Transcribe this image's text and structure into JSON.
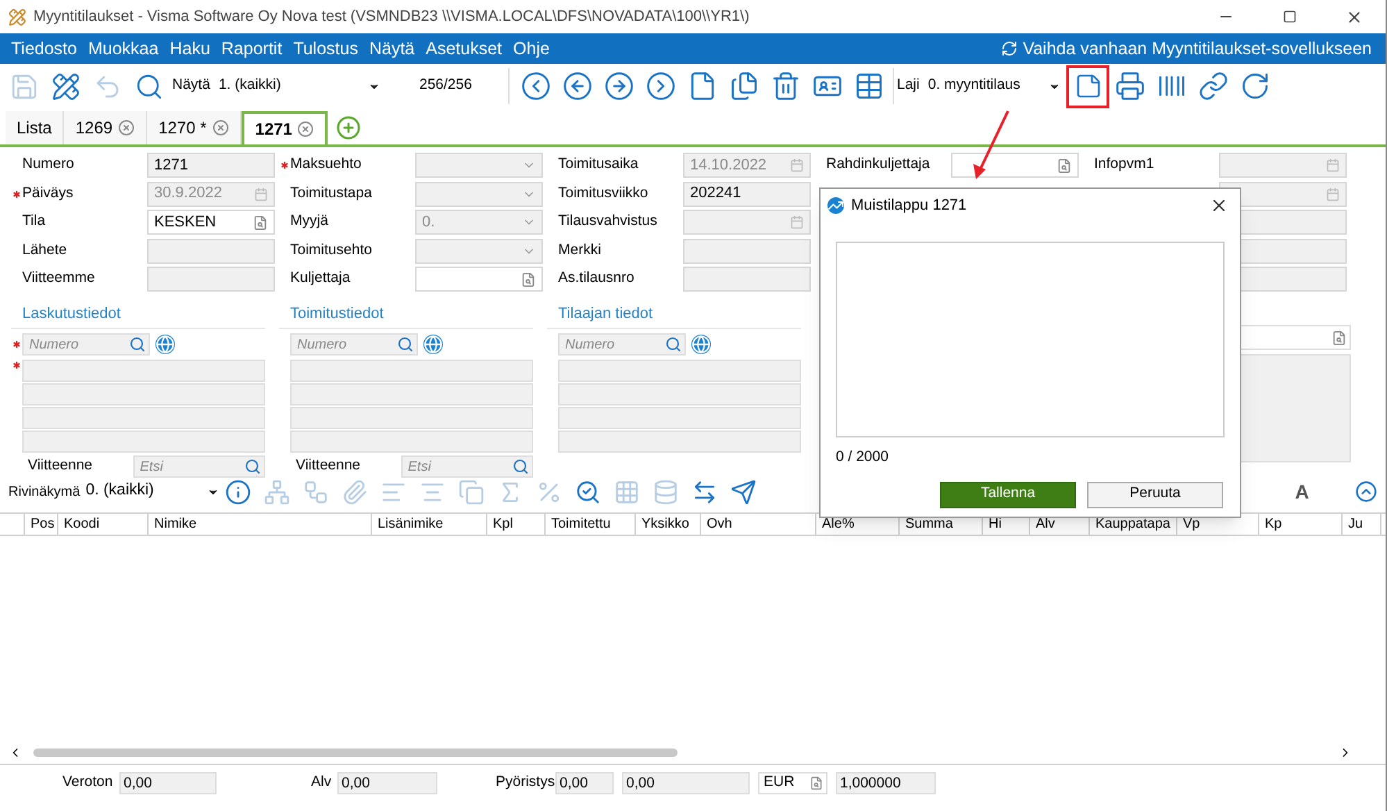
{
  "window": {
    "title": "Myyntitilaukset - Visma Software Oy Nova test (VSMNDB23 \\\\VISMA.LOCAL\\DFS\\NOVADATA\\100\\\\YR1\\)"
  },
  "menu": [
    "Tiedosto",
    "Muokkaa",
    "Haku",
    "Raportit",
    "Tulostus",
    "Näytä",
    "Asetukset",
    "Ohje"
  ],
  "switch_link": "Vaihda vanhaan Myyntitilaukset-sovellukseen",
  "toolbar": {
    "view_label": "Näytä",
    "view_value": "1. (kaikki)",
    "counter": "256/256",
    "type_label": "Laji",
    "type_value": "0. myyntitilaus",
    "icons": [
      {
        "disabled": true
      },
      {
        "disabled": false
      },
      {
        "disabled": true
      },
      {
        "disabled": false
      }
    ]
  },
  "tabs": [
    {
      "label": "Lista",
      "closable": false,
      "selected": false
    },
    {
      "label": "1269",
      "closable": true,
      "selected": false
    },
    {
      "label": "1270 *",
      "closable": true,
      "selected": false
    },
    {
      "label": "1271",
      "closable": true,
      "selected": true
    }
  ],
  "form": {
    "columns": [
      {
        "fields": [
          {
            "label": "Numero",
            "value": "1271",
            "kind": "text",
            "required": false,
            "disabled": false
          },
          {
            "label": "Päiväys",
            "value": "30.9.2022",
            "kind": "date",
            "required": true,
            "disabled": true
          },
          {
            "label": "Tila",
            "value": "KESKEN",
            "kind": "lookup",
            "required": false,
            "disabled": false
          },
          {
            "label": "Lähete",
            "kind": "text",
            "required": false
          },
          {
            "label": "Viitteemme",
            "kind": "text",
            "required": false
          }
        ]
      },
      {
        "fields": [
          {
            "label": "Maksuehto",
            "kind": "select",
            "required": true
          },
          {
            "label": "Toimitustapa",
            "kind": "select",
            "required": false
          },
          {
            "label": "Myyjä",
            "value": "0.",
            "kind": "select",
            "required": false,
            "disabled": true
          },
          {
            "label": "Toimitusehto",
            "kind": "select",
            "required": false
          },
          {
            "label": "Kuljettaja",
            "kind": "lookup",
            "required": false
          }
        ]
      },
      {
        "fields": [
          {
            "label": "Toimitusaika",
            "value": "14.10.2022",
            "kind": "date",
            "required": false,
            "disabled": true
          },
          {
            "label": "Toimitusviikko",
            "value": "202241",
            "kind": "text",
            "required": false,
            "disabled": false
          },
          {
            "label": "Tilausvahvistus",
            "kind": "date",
            "required": false
          },
          {
            "label": "Merkki",
            "kind": "text",
            "required": false
          },
          {
            "label": "As.tilausnro",
            "kind": "text",
            "required": false
          }
        ]
      },
      {
        "fields": [
          {
            "label": "Rahdinkuljettaja",
            "kind": "lookup",
            "required": false
          }
        ]
      },
      {
        "fields": [
          {
            "label": "Infopvm1",
            "kind": "date",
            "required": false
          },
          {
            "kind": "date"
          },
          {
            "kind": "text"
          },
          {
            "kind": "text"
          },
          {
            "kind": "text"
          }
        ]
      }
    ],
    "sections": [
      {
        "title": "Laskutustiedot",
        "number_placeholder": "Numero",
        "number_required": true,
        "lines": [
          {
            "required": true
          },
          {
            "required": false
          },
          {
            "required": false
          },
          {
            "required": false
          }
        ],
        "reference_label": "Viitteenne",
        "reference_placeholder": "Etsi"
      },
      {
        "title": "Toimitustiedot",
        "number_placeholder": "Numero",
        "number_required": false,
        "lines": [
          {
            "required": false
          },
          {
            "required": false
          },
          {
            "required": false
          },
          {
            "required": false
          }
        ],
        "reference_label": "Viitteenne",
        "reference_placeholder": "Etsi"
      },
      {
        "title": "Tilaajan tiedot",
        "number_placeholder": "Numero",
        "number_required": false,
        "lines": [
          {
            "required": false
          },
          {
            "required": false
          },
          {
            "required": false
          },
          {
            "required": false
          }
        ]
      }
    ]
  },
  "rows_toolbar": {
    "view_label": "Rivinäkymä",
    "view_value": "0. (kaikki)",
    "font_button": "A",
    "icons": [
      {
        "disabled": false
      },
      {
        "disabled": true
      },
      {
        "disabled": true
      },
      {
        "disabled": true
      },
      {
        "disabled": true
      },
      {
        "disabled": true
      },
      {
        "disabled": true
      },
      {
        "disabled": true
      },
      {
        "disabled": true
      },
      {
        "disabled": false
      },
      {
        "disabled": true
      },
      {
        "disabled": true
      },
      {
        "disabled": false
      },
      {
        "disabled": false
      }
    ]
  },
  "table": {
    "columns": [
      "Pos",
      "Koodi",
      "Nimike",
      "Lisänimike",
      "Kpl",
      "Toimitettu",
      "Yksikko",
      "Ovh",
      "Ale%",
      "Summa",
      "Hi",
      "Alv",
      "Kauppatapa",
      "Vp",
      "Kp",
      "Ju"
    ]
  },
  "totals": {
    "net_label": "Veroton",
    "net": "0,00",
    "vat_label": "Alv",
    "vat": "0,00",
    "rounding_label": "Pyöristys",
    "rounding": "0,00",
    "rounding_total": "0,00",
    "currency": "EUR",
    "rate": "1,000000"
  },
  "dialog": {
    "title": "Muistilappu 1271",
    "counter": "0 / 2000",
    "buttons": [
      {
        "label": "Tallenna",
        "kind": "primary"
      },
      {
        "label": "Peruuta",
        "kind": "secondary"
      }
    ]
  }
}
